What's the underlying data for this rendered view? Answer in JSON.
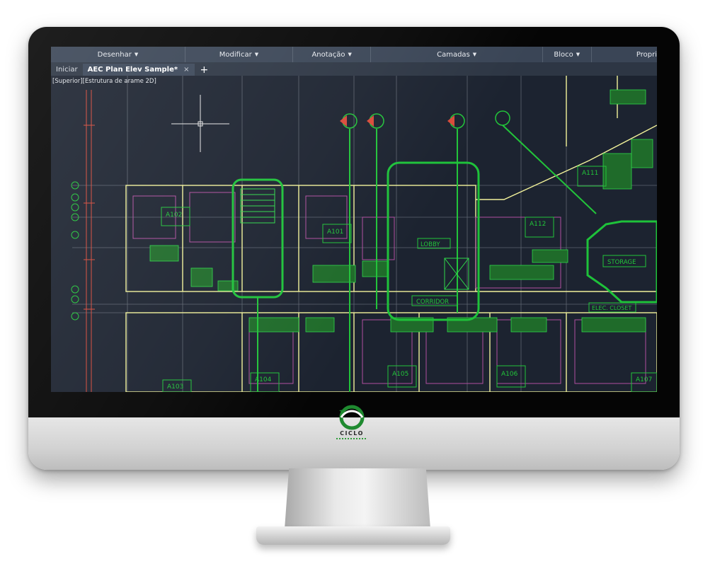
{
  "ribbon": {
    "panels": [
      {
        "label": "Desenhar"
      },
      {
        "label": "Modificar"
      },
      {
        "label": "Anotação"
      },
      {
        "label": "Camadas"
      },
      {
        "label": "Bloco"
      },
      {
        "label": "Propri"
      }
    ],
    "dropdown_icon": "chevron-down-icon"
  },
  "tabs": {
    "start": "Iniciar",
    "active": "AEC Plan Elev Sample*",
    "close_symbol": "×",
    "new_symbol": "+"
  },
  "viewport": {
    "label": "[Superior][Estrutura de arame 2D]"
  },
  "drawing": {
    "rooms": {
      "a101": "A101",
      "a102": "A102",
      "a103": "A103",
      "a104": "A104",
      "a105": "A105",
      "a106": "A106",
      "a107": "A107",
      "a111": "A111",
      "a112": "A112"
    },
    "labels": {
      "lobby": "LOBBY",
      "corridor": "CORRIDOR",
      "storage": "STORAGE",
      "elec_closet": "ELEC. CLOSET"
    }
  },
  "colors": {
    "screen_bg": "#1c2330",
    "ribbon_bg": "#3a4556",
    "cad_green": "#22c43a",
    "cad_yellow": "#f2f29a",
    "cad_magenta": "#b04fa0",
    "cad_red": "#d84a3a",
    "cad_grey": "#7d8490"
  },
  "brand": {
    "name": "CICLO",
    "accent": "#2e9d3a"
  }
}
